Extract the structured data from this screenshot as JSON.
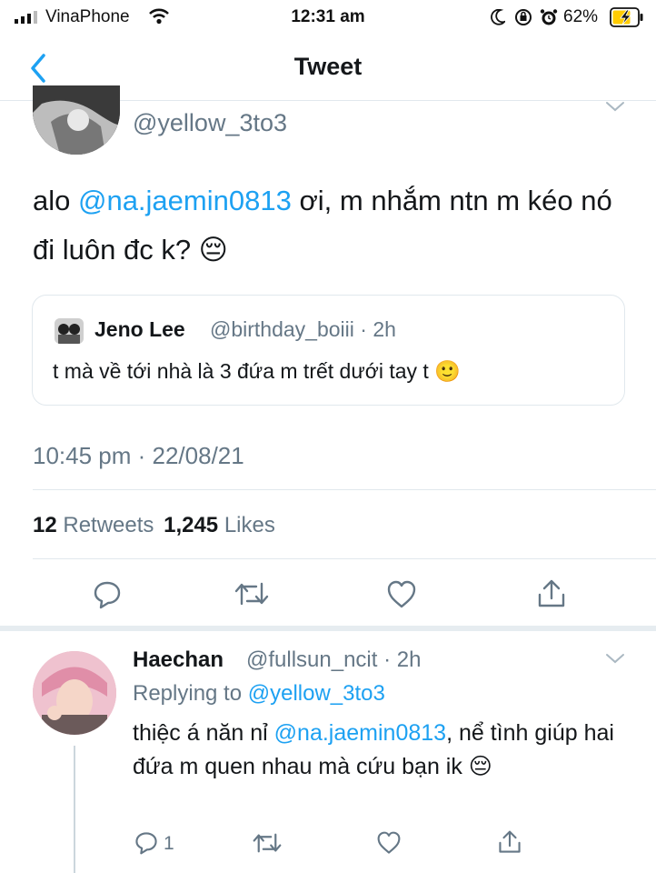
{
  "status_bar": {
    "carrier": "VinaPhone",
    "time": "12:31 am",
    "battery": "62%"
  },
  "nav": {
    "title": "Tweet"
  },
  "tweet": {
    "handle": "@yellow_3to3",
    "text_before": "alo ",
    "mention": "@na.jaemin0813",
    "text_after": " ơi, m nhắm ntn m kéo nó đi luôn đc k? 😔",
    "quote": {
      "name": "Jeno Lee",
      "handle_time": "@birthday_boiii · 2h",
      "text": "t mà về tới nhà là 3 đứa m trết dưới tay t 🙂"
    },
    "timestamp": "10:45 pm · 22/08/21",
    "retweet_count": "12",
    "retweets_label": "Retweets",
    "like_count": "1,245",
    "likes_label": "Likes"
  },
  "reply": {
    "name": "Haechan",
    "handle_time": "@fullsun_ncit · 2h",
    "replying_prefix": "Replying to ",
    "replying_handle": "@yellow_3to3",
    "text_before": "thiệc á năn nỉ ",
    "mention": "@na.jaemin0813",
    "text_after": ", nể tình giúp hai đứa m quen nhau mà cứu bạn ik 😔",
    "reply_count": "1"
  },
  "colors": {
    "accent": "#1da1f2",
    "secondary_text": "#657786",
    "divider": "#e1e8ed",
    "battery_fill": "#ffcc00"
  },
  "icons": [
    "signal-icon",
    "wifi-icon",
    "moon-icon",
    "rotation-lock-icon",
    "alarm-icon",
    "battery-icon",
    "back-chevron-icon",
    "chevron-down-icon",
    "reply-icon",
    "retweet-icon",
    "like-icon",
    "share-icon"
  ]
}
